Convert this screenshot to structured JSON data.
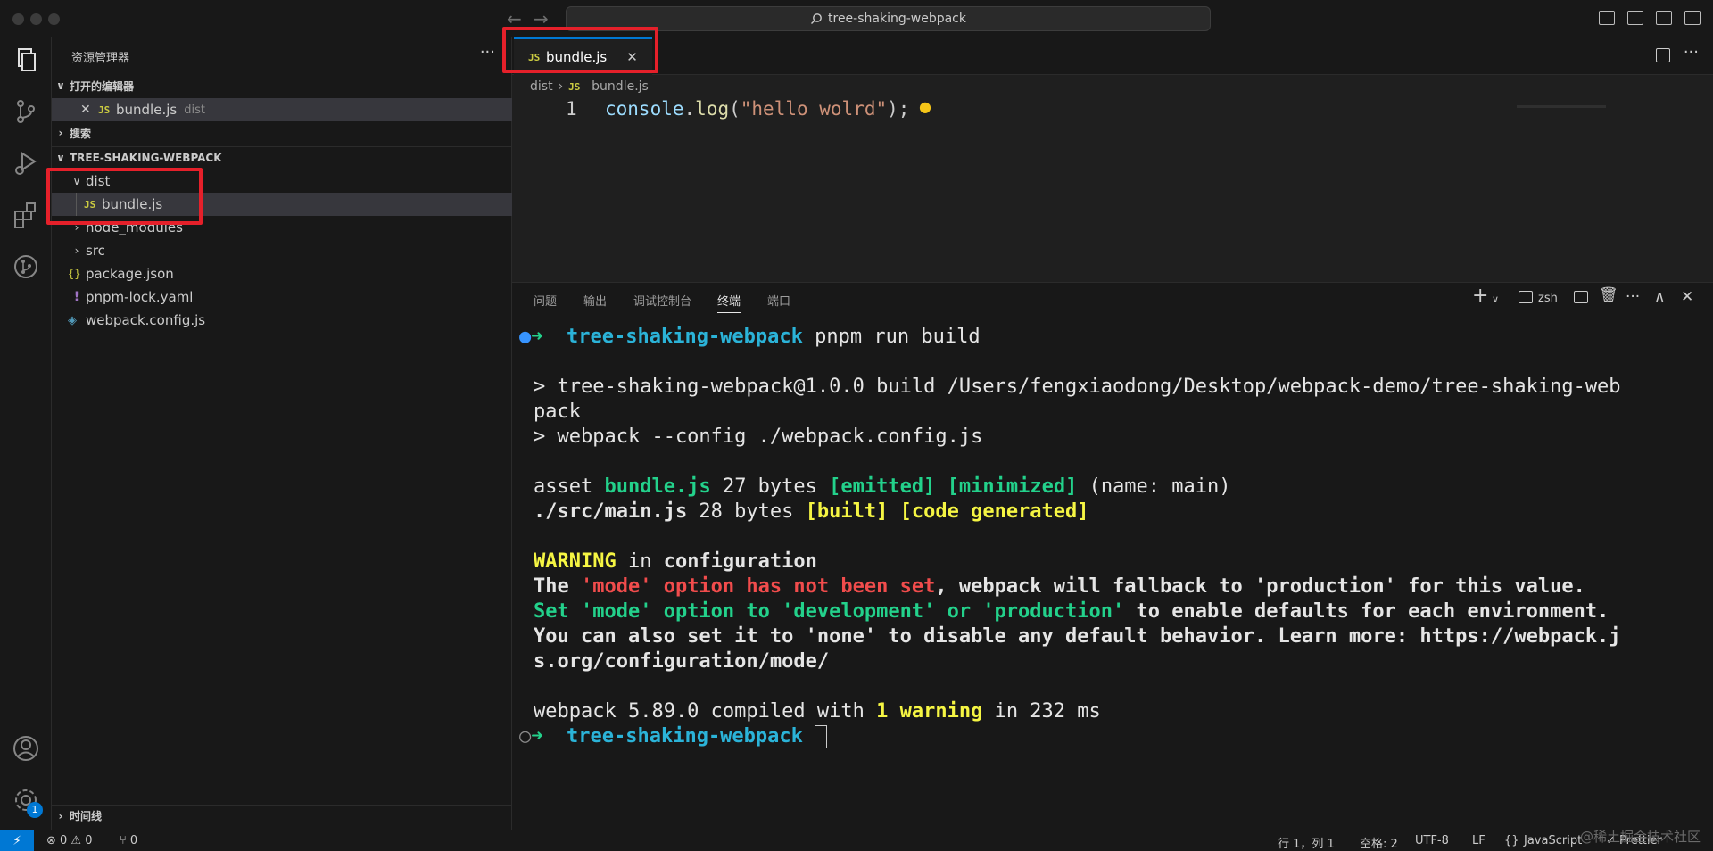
{
  "titlebar": {
    "search_text": "tree-shaking-webpack",
    "back_arrow": "←",
    "forward_arrow": "→"
  },
  "sidebar": {
    "title": "资源管理器",
    "more": "···",
    "open_editors_label": "打开的编辑器",
    "open_editor": {
      "close": "✕",
      "name": "bundle.js",
      "folder": "dist"
    },
    "search_label": "搜索",
    "project_label": "TREE-SHAKING-WEBPACK",
    "tree": [
      {
        "chev": "∨",
        "icon": "",
        "name": "dist"
      },
      {
        "chev": "",
        "icon": "JS",
        "name": "bundle.js"
      },
      {
        "chev": "›",
        "icon": "",
        "name": "node_modules"
      },
      {
        "chev": "›",
        "icon": "",
        "name": "src"
      },
      {
        "chev": "",
        "icon": "{}",
        "name": "package.json"
      },
      {
        "chev": "",
        "icon": "!",
        "name": "pnpm-lock.yaml"
      },
      {
        "chev": "",
        "icon": "◈",
        "name": "webpack.config.js"
      }
    ],
    "timeline_label": "时间线"
  },
  "editor": {
    "tab_icon": "JS",
    "tab_name": "bundle.js",
    "tab_close": "✕",
    "breadcrumb": {
      "folder": "dist",
      "sep": "›",
      "icon": "JS",
      "file": "bundle.js"
    },
    "line_number": "1",
    "code": {
      "obj": "console",
      "dot": ".",
      "fn": "log",
      "open": "(",
      "str": "\"hello wolrd\"",
      "close": ");"
    }
  },
  "panel": {
    "tabs": [
      "问题",
      "输出",
      "调试控制台",
      "终端",
      "端口"
    ],
    "active_tab": "终端",
    "shell": "zsh",
    "plus": "+",
    "terminal": {
      "prompt_arrow": "➜",
      "dir": "tree-shaking-webpack",
      "command": " pnpm run build",
      "script_line1": "> tree-shaking-webpack@1.0.0 build /Users/fengxiaodong/Desktop/webpack-demo/tree-shaking-web",
      "script_line2": "pack",
      "script_line3": "> webpack --config ./webpack.config.js",
      "asset_word": "asset ",
      "asset_file": "bundle.js",
      "asset_size": " 27 bytes ",
      "asset_emitted": "[emitted]",
      "asset_minimized": "[minimized]",
      "asset_name": " (name: main)",
      "module_path": "./src/main.js",
      "module_size": " 28 bytes ",
      "module_built": "[built]",
      "module_generated": "[code generated]",
      "warning_word": "WARNING",
      "warning_in": " in ",
      "warning_config": "configuration",
      "w1_the": "The ",
      "w1_mode": "'mode' option has not been set",
      "w1_rest": ", webpack will fallback to 'production' for this value.",
      "w2_set": "Set 'mode' option to 'development' or 'production'",
      "w2_rest": " to enable defaults for each environment.",
      "w3": "You can also set it to 'none' to disable any default behavior. Learn more: https://webpack.j",
      "w4": "s.org/configuration/mode/",
      "compiled_pre": "webpack 5.89.0 compiled with ",
      "compiled_warn": "1 warning",
      "compiled_post": " in 232 ms"
    }
  },
  "statusbar": {
    "remote": "⚡",
    "errors": "⊗ 0 ⚠ 0",
    "ports": "⑂ 0",
    "position": "行 1，列 1",
    "spaces": "空格: 2",
    "encoding": "UTF-8",
    "eol": "LF",
    "language": "JavaScript",
    "prettier": "✓ Prettier",
    "watermark": "@稀土掘金技术社区"
  },
  "activitybar": {
    "badge": "1"
  }
}
